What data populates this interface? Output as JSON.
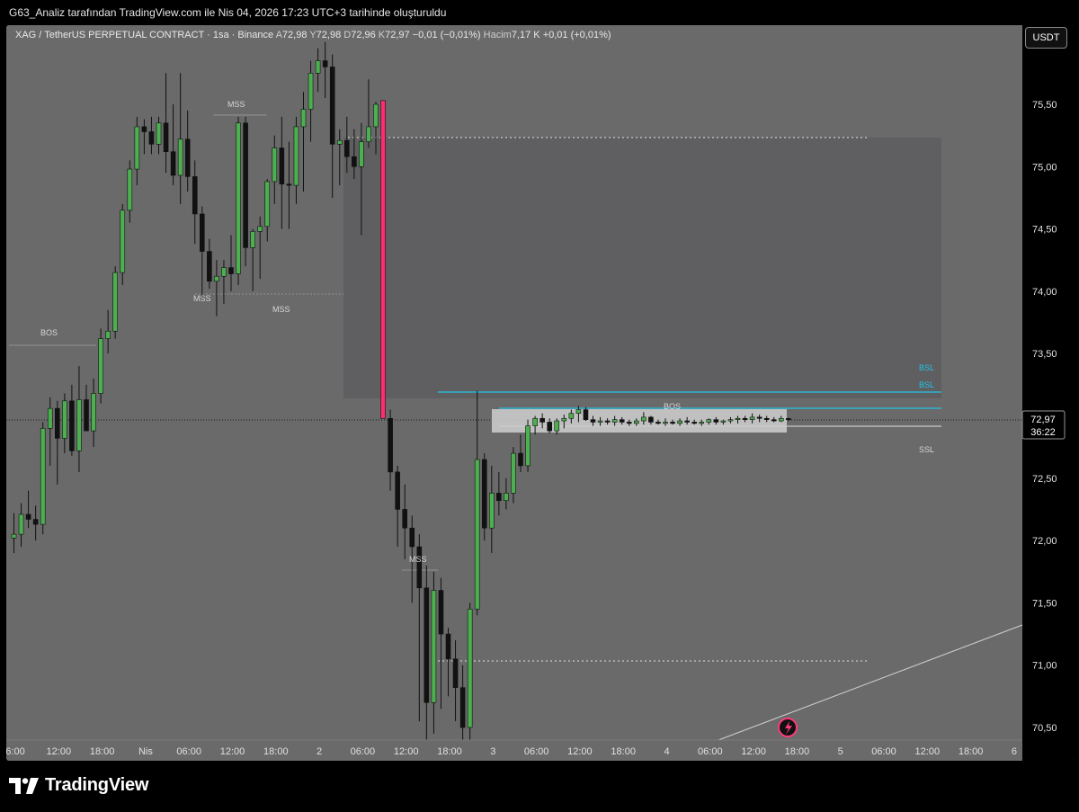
{
  "header": {
    "attribution": "G63_Analiz tarafından TradingView.com ile Nis 04, 2026 17:23 UTC+3 tarihinde oluşturuldu"
  },
  "legend": {
    "symbol": "XAG / TetherUS PERPETUAL CONTRACT · 1sa · Binance",
    "open_label": "A",
    "open": "72,98",
    "high_label": "Y",
    "high": "72,98",
    "low_label": "D",
    "low": "72,96",
    "close_label": "K",
    "close": "72,97",
    "change": "−0,01 (−0,01%)",
    "volume_label": "Hacim",
    "volume": "7,17 K",
    "volume_change": "+0,01 (+0,01%)"
  },
  "currency_button": "USDT",
  "price_axis": {
    "ticks": [
      "75,50",
      "75,00",
      "74,50",
      "74,00",
      "73,50",
      "73,00",
      "72,50",
      "72,00",
      "71,50",
      "71,00",
      "70,50"
    ],
    "current_price": "72,97",
    "countdown": "36:22"
  },
  "time_axis": {
    "ticks": [
      "6:00",
      "12:00",
      "18:00",
      "Nis",
      "06:00",
      "12:00",
      "18:00",
      "2",
      "06:00",
      "12:00",
      "18:00",
      "3",
      "06:00",
      "12:00",
      "18:00",
      "4",
      "06:00",
      "12:00",
      "18:00",
      "5",
      "06:00",
      "12:00",
      "18:00",
      "6"
    ]
  },
  "annotations": {
    "bos_left": "BOS",
    "mss_top": "MSS",
    "mss_mid_a": "MSS",
    "mss_mid_b": "MSS",
    "mss_low": "MSS",
    "bos_right": "BOS",
    "bsl_1": "BSL",
    "bsl_2": "BSL",
    "ssl": "SSL"
  },
  "footer": {
    "brand": "TradingView"
  },
  "colors": {
    "up": "#4caf50",
    "down": "#111111",
    "impulse": "#ff2d6f",
    "bsl": "#22c3e6",
    "panel": "#6a6a6a"
  },
  "chart_data": {
    "type": "candlestick",
    "ylim": [
      70.4,
      76.0
    ],
    "price_ticks": [
      75.5,
      75.0,
      74.5,
      74.0,
      73.5,
      73.0,
      72.5,
      72.0,
      71.5,
      71.0,
      70.5
    ],
    "current_price": 72.97,
    "candles": [
      [
        72.02,
        72.22,
        71.9,
        72.05
      ],
      [
        72.05,
        72.3,
        71.95,
        72.21
      ],
      [
        72.21,
        72.4,
        72.1,
        72.17
      ],
      [
        72.17,
        72.28,
        72.0,
        72.13
      ],
      [
        72.13,
        72.95,
        72.05,
        72.9
      ],
      [
        72.9,
        73.15,
        72.6,
        73.06
      ],
      [
        73.06,
        73.12,
        72.45,
        72.82
      ],
      [
        72.82,
        73.18,
        72.7,
        73.12
      ],
      [
        73.12,
        73.25,
        72.68,
        72.72
      ],
      [
        72.72,
        73.4,
        72.55,
        73.13
      ],
      [
        73.13,
        73.25,
        72.9,
        72.88
      ],
      [
        72.88,
        73.3,
        72.75,
        73.18
      ],
      [
        73.18,
        73.7,
        73.1,
        73.62
      ],
      [
        73.62,
        73.85,
        73.5,
        73.68
      ],
      [
        73.68,
        74.2,
        73.62,
        74.15
      ],
      [
        74.15,
        74.7,
        74.05,
        74.65
      ],
      [
        74.65,
        75.05,
        74.55,
        74.98
      ],
      [
        74.98,
        75.4,
        74.85,
        75.32
      ],
      [
        75.32,
        75.38,
        75.1,
        75.28
      ],
      [
        75.28,
        75.4,
        75.1,
        75.18
      ],
      [
        75.18,
        75.4,
        75.1,
        75.35
      ],
      [
        75.35,
        75.75,
        74.95,
        75.12
      ],
      [
        75.12,
        75.5,
        74.85,
        74.93
      ],
      [
        74.93,
        75.75,
        74.7,
        75.22
      ],
      [
        75.22,
        75.45,
        74.8,
        74.92
      ],
      [
        74.92,
        75.05,
        74.38,
        74.62
      ],
      [
        74.62,
        74.68,
        73.95,
        74.32
      ],
      [
        74.32,
        74.42,
        74.02,
        74.08
      ],
      [
        74.08,
        74.25,
        73.8,
        74.12
      ],
      [
        74.12,
        74.25,
        73.9,
        74.19
      ],
      [
        74.19,
        74.45,
        74.0,
        74.14
      ],
      [
        74.14,
        75.4,
        74.05,
        75.35
      ],
      [
        75.35,
        75.4,
        74.2,
        74.35
      ],
      [
        74.35,
        74.5,
        74.0,
        74.48
      ],
      [
        74.48,
        74.6,
        74.1,
        74.52
      ],
      [
        74.52,
        74.9,
        74.4,
        74.88
      ],
      [
        74.88,
        75.25,
        74.7,
        75.15
      ],
      [
        75.15,
        75.4,
        74.5,
        74.86
      ],
      [
        74.86,
        75.2,
        74.5,
        74.85
      ],
      [
        74.85,
        75.4,
        74.7,
        75.32
      ],
      [
        75.32,
        75.6,
        74.8,
        75.46
      ],
      [
        75.46,
        75.85,
        75.2,
        75.75
      ],
      [
        75.75,
        75.95,
        75.6,
        75.85
      ],
      [
        75.85,
        76.0,
        75.55,
        75.8
      ],
      [
        75.8,
        75.9,
        74.75,
        75.18
      ],
      [
        75.18,
        75.3,
        74.85,
        75.21
      ],
      [
        75.21,
        75.4,
        74.95,
        75.08
      ],
      [
        75.08,
        75.3,
        74.9,
        75.0
      ],
      [
        75.0,
        75.35,
        74.45,
        75.2
      ],
      [
        75.2,
        75.7,
        75.15,
        75.32
      ],
      [
        75.32,
        75.52,
        75.1,
        75.5
      ],
      [
        75.53,
        75.53,
        72.98,
        72.98
      ],
      [
        72.98,
        73.05,
        72.4,
        72.55
      ],
      [
        72.55,
        72.6,
        71.95,
        72.25
      ],
      [
        72.25,
        72.45,
        71.85,
        72.1
      ],
      [
        72.1,
        72.2,
        71.5,
        71.95
      ],
      [
        71.95,
        72.05,
        70.55,
        71.62
      ],
      [
        71.62,
        71.8,
        70.3,
        70.7
      ],
      [
        70.7,
        71.75,
        70.45,
        71.6
      ],
      [
        71.6,
        71.7,
        70.65,
        71.25
      ],
      [
        71.25,
        71.3,
        70.75,
        71.05
      ],
      [
        71.05,
        71.2,
        70.55,
        70.82
      ],
      [
        70.82,
        71.0,
        70.3,
        70.5
      ],
      [
        70.5,
        71.5,
        70.2,
        71.45
      ],
      [
        71.45,
        73.2,
        71.4,
        72.65
      ],
      [
        72.65,
        72.7,
        72.0,
        72.1
      ],
      [
        72.1,
        72.6,
        71.9,
        72.38
      ],
      [
        72.38,
        72.55,
        72.2,
        72.32
      ],
      [
        72.32,
        72.5,
        72.25,
        72.38
      ],
      [
        72.38,
        72.75,
        72.3,
        72.7
      ],
      [
        72.7,
        72.85,
        72.55,
        72.6
      ],
      [
        72.6,
        72.97,
        72.55,
        72.92
      ],
      [
        72.92,
        73.0,
        72.85,
        72.98
      ],
      [
        72.98,
        73.02,
        72.9,
        72.95
      ],
      [
        72.95,
        72.98,
        72.86,
        72.88
      ],
      [
        72.88,
        72.98,
        72.85,
        72.96
      ],
      [
        72.96,
        73.01,
        72.9,
        72.98
      ],
      [
        72.98,
        73.05,
        72.94,
        73.02
      ],
      [
        73.02,
        73.08,
        72.95,
        73.05
      ],
      [
        73.05,
        73.07,
        72.96,
        72.97
      ],
      [
        72.97,
        73.0,
        72.92,
        72.95
      ],
      [
        72.95,
        72.99,
        72.92,
        72.96
      ],
      [
        72.96,
        72.98,
        72.93,
        72.95
      ],
      [
        72.95,
        73.0,
        72.92,
        72.97
      ],
      [
        72.97,
        72.99,
        72.93,
        72.95
      ],
      [
        72.95,
        72.97,
        72.92,
        72.94
      ],
      [
        72.94,
        72.98,
        72.92,
        72.96
      ],
      [
        72.96,
        73.03,
        72.93,
        72.99
      ],
      [
        72.99,
        73.0,
        72.93,
        72.95
      ],
      [
        72.95,
        72.97,
        72.93,
        72.94
      ],
      [
        72.94,
        72.98,
        72.92,
        72.95
      ],
      [
        72.95,
        72.97,
        72.93,
        72.94
      ],
      [
        72.94,
        72.98,
        72.92,
        72.96
      ],
      [
        72.96,
        72.99,
        72.93,
        72.95
      ],
      [
        72.95,
        72.97,
        72.93,
        72.94
      ],
      [
        72.94,
        72.97,
        72.92,
        72.95
      ],
      [
        72.95,
        72.98,
        72.93,
        72.97
      ],
      [
        72.97,
        72.99,
        72.93,
        72.95
      ],
      [
        72.95,
        72.97,
        72.93,
        72.96
      ],
      [
        72.96,
        72.99,
        72.94,
        72.97
      ],
      [
        72.97,
        73.0,
        72.94,
        72.98
      ],
      [
        72.98,
        73.0,
        72.95,
        72.97
      ],
      [
        72.97,
        73.02,
        72.94,
        72.99
      ],
      [
        72.99,
        73.01,
        72.95,
        72.98
      ],
      [
        72.98,
        73.0,
        72.95,
        72.97
      ],
      [
        72.97,
        72.99,
        72.95,
        72.96
      ],
      [
        72.96,
        73.0,
        72.95,
        72.98
      ],
      [
        72.98,
        72.98,
        72.96,
        72.97
      ]
    ],
    "levels": {
      "bsl": [
        73.18,
        73.05
      ],
      "ssl": 72.92,
      "dotted_high": 75.23,
      "dotted_low": 71.03,
      "fvg": [
        73.15,
        75.25
      ],
      "range_box": [
        72.87,
        73.05
      ]
    }
  }
}
